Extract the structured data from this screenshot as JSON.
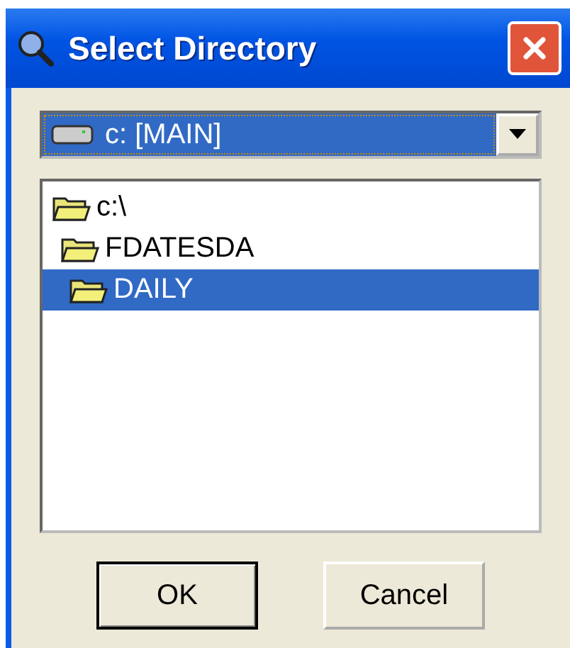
{
  "window": {
    "title": "Select Directory"
  },
  "drive": {
    "value": "c: [MAIN]"
  },
  "folders": [
    {
      "label": "c:\\",
      "selected": false,
      "children": [
        {
          "label": "FDATESDA",
          "selected": false,
          "children": [
            {
              "label": "DAILY",
              "selected": true
            }
          ]
        }
      ]
    }
  ],
  "buttons": [
    {
      "label": "OK",
      "default": true
    },
    {
      "label": "Cancel",
      "default": false
    }
  ]
}
